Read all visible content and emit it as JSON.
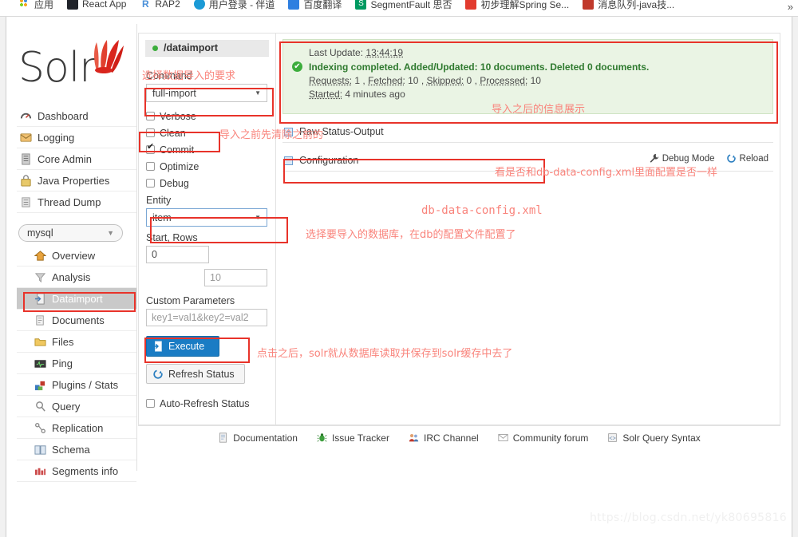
{
  "browser": {
    "bookmarks": [
      {
        "label": "应用",
        "icon": "apps-grid-icon",
        "color": "#f5a623"
      },
      {
        "label": "React App",
        "icon": "react-icon",
        "color": "#20232a"
      },
      {
        "label": "RAP2",
        "icon": "rap2-icon",
        "color": "#4a90d9"
      },
      {
        "label": "用户登录 - 伴道",
        "icon": "user-login-icon",
        "color": "#1b9ad6"
      },
      {
        "label": "百度翻译",
        "icon": "baidu-translate-icon",
        "color": "#2e7fe0"
      },
      {
        "label": "SegmentFault 思否",
        "icon": "segmentfault-icon",
        "color": "#009a61"
      },
      {
        "label": "初步理解Spring Se...",
        "icon": "bookmark-icon",
        "color": "#e23b2e"
      },
      {
        "label": "消息队列-java技...",
        "icon": "bookmark-icon",
        "color": "#c0392b"
      }
    ],
    "overflow_label": "»"
  },
  "sidebar": {
    "logo_text": "Solr",
    "items": [
      {
        "label": "Dashboard",
        "icon": "dashboard-icon",
        "active": false
      },
      {
        "label": "Logging",
        "icon": "logging-icon",
        "active": false
      },
      {
        "label": "Core Admin",
        "icon": "core-admin-icon",
        "active": false
      },
      {
        "label": "Java Properties",
        "icon": "java-properties-icon",
        "active": false
      },
      {
        "label": "Thread Dump",
        "icon": "thread-dump-icon",
        "active": false
      }
    ],
    "core_selector": {
      "value": "mysql",
      "caret": "▼"
    },
    "core_items": [
      {
        "label": "Overview",
        "icon": "home-icon",
        "active": false
      },
      {
        "label": "Analysis",
        "icon": "funnel-icon",
        "active": false
      },
      {
        "label": "Dataimport",
        "icon": "dataimport-icon",
        "active": true
      },
      {
        "label": "Documents",
        "icon": "documents-icon",
        "active": false
      },
      {
        "label": "Files",
        "icon": "folder-icon",
        "active": false
      },
      {
        "label": "Ping",
        "icon": "ping-icon",
        "active": false
      },
      {
        "label": "Plugins / Stats",
        "icon": "plugins-icon",
        "active": false
      },
      {
        "label": "Query",
        "icon": "magnifier-icon",
        "active": false
      },
      {
        "label": "Replication",
        "icon": "replication-icon",
        "active": false
      },
      {
        "label": "Schema",
        "icon": "book-icon",
        "active": false
      },
      {
        "label": "Segments info",
        "icon": "segments-icon",
        "active": false
      }
    ]
  },
  "dataimport": {
    "handler_label": "/dataimport",
    "command_label": "Command",
    "command_value": "full-import",
    "checkboxes": [
      {
        "label": "Verbose",
        "checked": false
      },
      {
        "label": "Clean",
        "checked": false
      },
      {
        "label": "Commit",
        "checked": true
      },
      {
        "label": "Optimize",
        "checked": false
      },
      {
        "label": "Debug",
        "checked": false
      }
    ],
    "entity_label": "Entity",
    "entity_value": "item",
    "start_rows_label": "Start, Rows",
    "start_value": "0",
    "rows_value": "10",
    "custom_params_label": "Custom Parameters",
    "custom_params_placeholder": "key1=val1&key2=val2",
    "execute_label": "Execute",
    "refresh_label": "Refresh Status",
    "auto_refresh_label": "Auto-Refresh Status",
    "auto_refresh_checked": false
  },
  "status": {
    "last_update_label": "Last Update:",
    "last_update_value": "13:44:19",
    "main_message": "Indexing completed. Added/Updated: 10 documents. Deleted 0 documents.",
    "requests_label": "Requests:",
    "requests_value": "1",
    "fetched_label": "Fetched:",
    "fetched_value": "10",
    "skipped_label": "Skipped:",
    "skipped_value": "0",
    "processed_label": "Processed:",
    "processed_value": "10",
    "started_label": "Started:",
    "started_value": "4 minutes ago"
  },
  "panels": {
    "raw_status_label": "Raw Status-Output",
    "configuration_label": "Configuration",
    "debug_mode_label": "Debug Mode",
    "reload_label": "Reload"
  },
  "footer": {
    "links": [
      {
        "label": "Documentation",
        "icon": "document-icon"
      },
      {
        "label": "Issue Tracker",
        "icon": "bug-icon"
      },
      {
        "label": "IRC Channel",
        "icon": "people-icon"
      },
      {
        "label": "Community forum",
        "icon": "envelope-icon"
      },
      {
        "label": "Solr Query Syntax",
        "icon": "code-icon"
      }
    ]
  },
  "annotations": {
    "color": "#f9847c",
    "box_color": "#e8332a",
    "a1": "选择数据导入的要求",
    "a2": "导入之前先清除之前的",
    "a3": "导入之后的信息展示",
    "a4": "看是否和db-data-config.xml里面配置是否一样",
    "a5": "db-data-config.xml",
    "a6": "选择要导入的数据库，在db的配置文件配置了",
    "a7": "点击之后，solr就从数据库读取并保存到solr缓存中去了"
  },
  "watermark": "https://blog.csdn.net/yk80695816"
}
